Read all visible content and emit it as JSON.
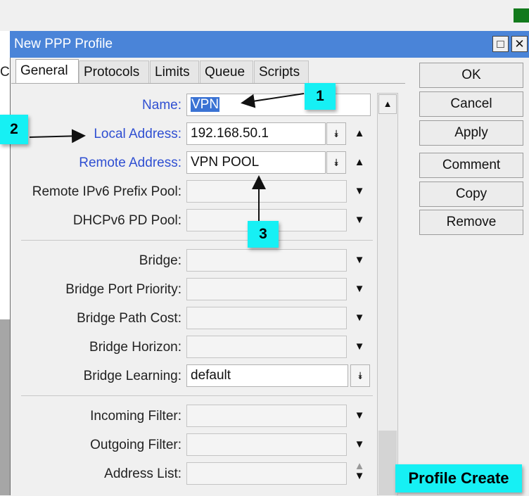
{
  "window": {
    "title": "New PPP Profile",
    "maximize_glyph": "□",
    "close_glyph": "✕"
  },
  "background": {
    "left_tab_label": "C",
    "accent_color": "#127a1c"
  },
  "tabs": [
    {
      "label": "General",
      "active": true
    },
    {
      "label": "Protocols",
      "active": false
    },
    {
      "label": "Limits",
      "active": false
    },
    {
      "label": "Queue",
      "active": false
    },
    {
      "label": "Scripts",
      "active": false
    }
  ],
  "form": {
    "name": {
      "label": "Name:",
      "value": "VPN"
    },
    "local_address": {
      "label": "Local Address:",
      "value": "192.168.50.1"
    },
    "remote_address": {
      "label": "Remote Address:",
      "value": "VPN POOL"
    },
    "remote_ipv6_prefix_pool": {
      "label": "Remote IPv6 Prefix Pool:",
      "value": ""
    },
    "dhcpv6_pd_pool": {
      "label": "DHCPv6 PD Pool:",
      "value": ""
    },
    "bridge": {
      "label": "Bridge:",
      "value": ""
    },
    "bridge_port_priority": {
      "label": "Bridge Port Priority:",
      "value": ""
    },
    "bridge_path_cost": {
      "label": "Bridge Path Cost:",
      "value": ""
    },
    "bridge_horizon": {
      "label": "Bridge Horizon:",
      "value": ""
    },
    "bridge_learning": {
      "label": "Bridge Learning:",
      "value": "default"
    },
    "incoming_filter": {
      "label": "Incoming Filter:",
      "value": ""
    },
    "outgoing_filter": {
      "label": "Outgoing Filter:",
      "value": ""
    },
    "address_list": {
      "label": "Address List:",
      "value": ""
    }
  },
  "buttons": {
    "ok": "OK",
    "cancel": "Cancel",
    "apply": "Apply",
    "comment": "Comment",
    "copy": "Copy",
    "remove": "Remove"
  },
  "annotations": {
    "callout_1": "1",
    "callout_2": "2",
    "callout_3": "3",
    "banner": "Profile Create",
    "callout_color": "#16f0f4"
  },
  "colors": {
    "titlebar": "#4a84d8",
    "blue_label": "#2f4fd2",
    "selection": "#3b73d4"
  }
}
